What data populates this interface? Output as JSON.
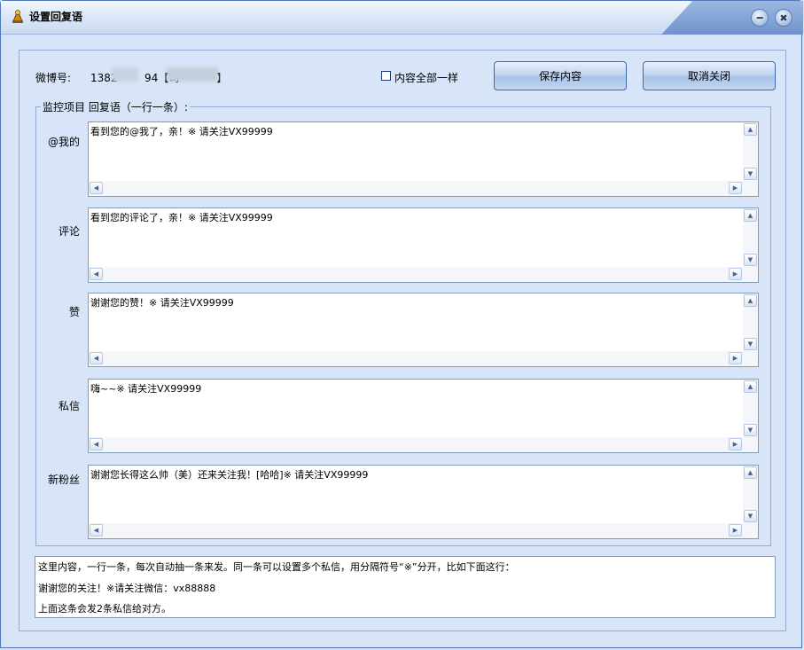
{
  "window": {
    "title": "设置回复语"
  },
  "header": {
    "weibo_label": "微博号:",
    "weibo_value": "1382        94【司           】",
    "same_content_label": "内容全部一样",
    "same_content_checked": false,
    "save_label": "保存内容",
    "cancel_label": "取消关闭"
  },
  "group": {
    "legend": "监控项目 回复语（一行一条）:"
  },
  "rows": [
    {
      "label": "@我的",
      "text": "看到您的@我了，亲！※ 请关注VX99999"
    },
    {
      "label": "评论",
      "text": "看到您的评论了，亲！※ 请关注VX99999"
    },
    {
      "label": "赞",
      "text": "谢谢您的赞！※ 请关注VX99999"
    },
    {
      "label": "私信",
      "text": "嗨~~※ 请关注VX99999"
    },
    {
      "label": "新粉丝",
      "text": "谢谢您长得这么帅（美）还来关注我！[哈哈]※ 请关注VX99999"
    }
  ],
  "info": {
    "line1": "这里内容，一行一条，每次自动抽一条来发。同一条可以设置多个私信，用分隔符号“※”分开，比如下面这行：",
    "line2": "谢谢您的关注！※请关注微信：vx88888",
    "line3": "上面这条会发2条私信给对方。"
  }
}
